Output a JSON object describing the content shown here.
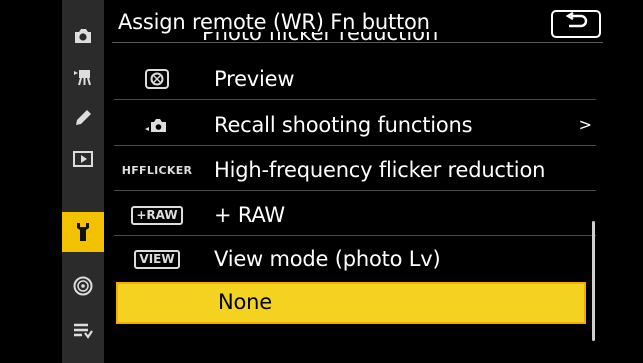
{
  "header": {
    "title": "Assign remote (WR) Fn button",
    "back_icon": "return-icon"
  },
  "sidebar": {
    "tabs": [
      {
        "name": "photo-shooting-tab",
        "icon": "camera-icon"
      },
      {
        "name": "movie-recording-tab",
        "icon": "movie-camera-icon"
      },
      {
        "name": "custom-settings-tab",
        "icon": "pencil-icon"
      },
      {
        "name": "playback-tab",
        "icon": "playback-icon"
      },
      {
        "name": "setup-tab",
        "icon": "wrench-icon",
        "active": true
      },
      {
        "name": "network-tab",
        "icon": "network-icon"
      },
      {
        "name": "my-menu-tab",
        "icon": "list-icon"
      }
    ],
    "active_color": "#f2c200"
  },
  "list": {
    "cut_off_label": "Photo flicker reduction",
    "items": [
      {
        "icon_text": "",
        "label": "Preview",
        "has_arrow": false
      },
      {
        "icon_text": "",
        "label": "Recall shooting functions",
        "has_arrow": true,
        "arrow": ">"
      },
      {
        "icon_text": "HFFLICKER",
        "label": "High-frequency flicker reduction",
        "has_arrow": false
      },
      {
        "icon_text": "+RAW",
        "label": "+ RAW",
        "has_arrow": false
      },
      {
        "icon_text": "VIEW",
        "label": "View mode (photo Lv)",
        "has_arrow": false
      },
      {
        "icon_text": "",
        "label": "None",
        "has_arrow": false,
        "selected": true
      }
    ],
    "selected_color": "#f4d320"
  }
}
